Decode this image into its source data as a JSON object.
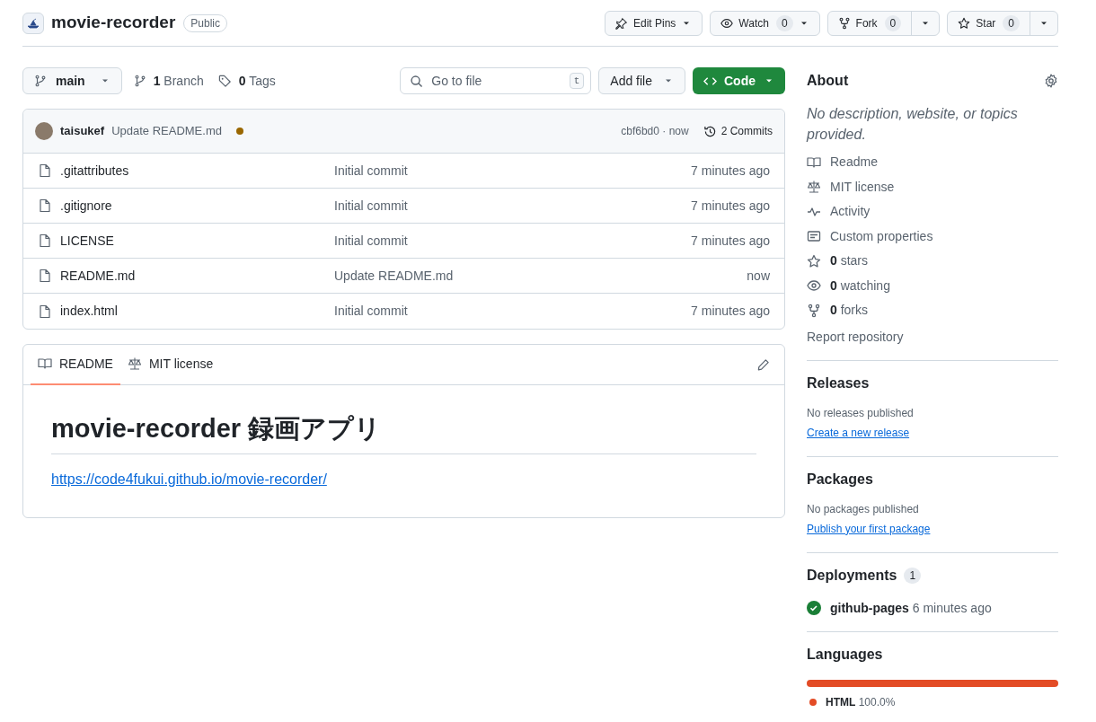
{
  "repo": {
    "name": "movie-recorder",
    "visibility": "Public"
  },
  "header_actions": [
    {
      "kind": "pins",
      "label": "Edit Pins"
    },
    {
      "kind": "watch",
      "label": "Watch",
      "count": "0"
    },
    {
      "kind": "fork",
      "label": "Fork",
      "count": "0"
    },
    {
      "kind": "star",
      "label": "Star",
      "count": "0"
    }
  ],
  "toolbar": {
    "branch": "main",
    "branch_count": "1",
    "branch_label": "Branch",
    "tag_count": "0",
    "tag_label": "Tags",
    "search": {
      "placeholder": "Go to file",
      "shortcut": "t"
    },
    "add_file": "Add file",
    "code": "Code"
  },
  "latest_commit": {
    "author": "taisukef",
    "message": "Update README.md",
    "hash": "cbf6bd0 · now",
    "commits": "2 Commits"
  },
  "files": [
    {
      "name": ".gitattributes",
      "message": "Initial commit",
      "time": "7 minutes ago"
    },
    {
      "name": ".gitignore",
      "message": "Initial commit",
      "time": "7 minutes ago"
    },
    {
      "name": "LICENSE",
      "message": "Initial commit",
      "time": "7 minutes ago"
    },
    {
      "name": "README.md",
      "message": "Update README.md",
      "time": "now"
    },
    {
      "name": "index.html",
      "message": "Initial commit",
      "time": "7 minutes ago"
    }
  ],
  "readme": {
    "tabs": [
      {
        "kind": "readme",
        "label": "README",
        "selected": true
      },
      {
        "kind": "license",
        "label": "MIT license",
        "selected": false
      }
    ],
    "heading": "movie-recorder 録画アプリ",
    "link": "https://code4fukui.github.io/movie-recorder/"
  },
  "about": {
    "heading": "About",
    "description": "No description, website, or topics provided.",
    "links": [
      {
        "kind": "readme",
        "label": "Readme"
      },
      {
        "kind": "license",
        "label": "MIT license"
      },
      {
        "kind": "activity",
        "label": "Activity"
      },
      {
        "kind": "properties",
        "label": "Custom properties"
      },
      {
        "kind": "star",
        "count": "0",
        "label": "stars"
      },
      {
        "kind": "eye",
        "count": "0",
        "label": "watching"
      },
      {
        "kind": "fork",
        "count": "0",
        "label": "forks"
      }
    ],
    "report": "Report repository"
  },
  "releases": {
    "heading": "Releases",
    "note": "No releases published",
    "link": "Create a new release"
  },
  "packages": {
    "heading": "Packages",
    "note": "No packages published",
    "link": "Publish your first package"
  },
  "deployments": {
    "heading": "Deployments",
    "count": "1",
    "items": [
      {
        "name": "github-pages",
        "time": "6 minutes ago"
      }
    ]
  },
  "languages": {
    "heading": "Languages",
    "items": [
      {
        "name": "HTML",
        "percent": "100.0%",
        "color": "#e34c26",
        "level": 1
      }
    ]
  }
}
